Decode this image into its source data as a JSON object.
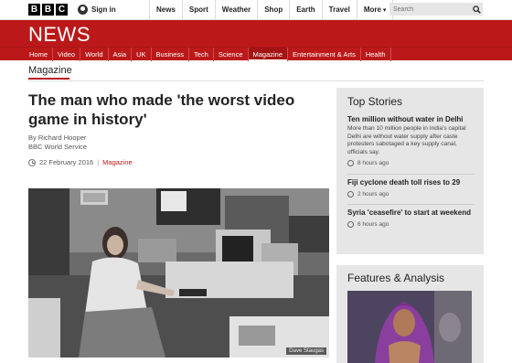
{
  "masthead": {
    "logo_letters": [
      "B",
      "B",
      "C"
    ],
    "signin_label": "Sign in",
    "nav": [
      "News",
      "Sport",
      "Weather",
      "Shop",
      "Earth",
      "Travel",
      "More"
    ],
    "search_placeholder": "Search"
  },
  "banner": {
    "title": "NEWS"
  },
  "sections": [
    "Home",
    "Video",
    "World",
    "Asia",
    "UK",
    "Business",
    "Tech",
    "Science",
    "Magazine",
    "Entertainment & Arts",
    "Health"
  ],
  "active_section": "Magazine",
  "page_section": "Magazine",
  "article": {
    "headline": "The man who made 'the worst video game in history'",
    "byline_author": "By Richard Hooper",
    "byline_org": "BBC World Service",
    "date": "22 February 2016",
    "section_link": "Magazine",
    "photo_credit": "Dave Staugas"
  },
  "top_stories": {
    "title": "Top Stories",
    "items": [
      {
        "title": "Ten million without water in Delhi",
        "summary": "More than 10 million people in India's capital Delhi are without water supply after caste protesters sabotaged a key supply canal, officials say.",
        "time": "8 hours ago"
      },
      {
        "title": "Fiji cyclone death toll rises to 29",
        "summary": "",
        "time": "2 hours ago"
      },
      {
        "title": "Syria 'ceasefire' to start at weekend",
        "summary": "",
        "time": "6 hours ago"
      }
    ]
  },
  "features": {
    "title": "Features & Analysis"
  },
  "colors": {
    "brand_red": "#bb1919",
    "panel_grey": "#e6e6e6"
  }
}
